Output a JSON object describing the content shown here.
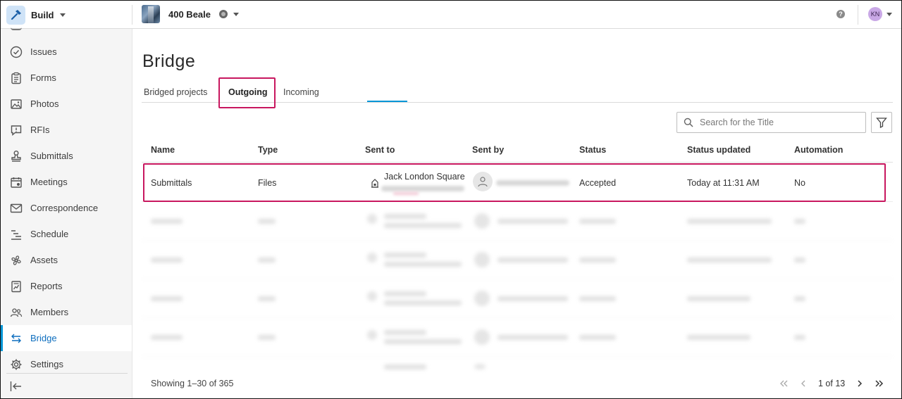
{
  "topbar": {
    "app_name": "Build",
    "project_name": "400 Beale",
    "user_initials": "KN"
  },
  "sidebar": {
    "items": [
      {
        "label": "Issues",
        "icon": "check-circle-icon"
      },
      {
        "label": "Forms",
        "icon": "clipboard-icon"
      },
      {
        "label": "Photos",
        "icon": "photos-icon"
      },
      {
        "label": "RFIs",
        "icon": "rfi-icon"
      },
      {
        "label": "Submittals",
        "icon": "stamp-icon"
      },
      {
        "label": "Meetings",
        "icon": "calendar-icon"
      },
      {
        "label": "Correspondence",
        "icon": "envelope-icon"
      },
      {
        "label": "Schedule",
        "icon": "schedule-icon"
      },
      {
        "label": "Assets",
        "icon": "fan-icon"
      },
      {
        "label": "Reports",
        "icon": "report-icon"
      },
      {
        "label": "Members",
        "icon": "members-icon"
      },
      {
        "label": "Bridge",
        "icon": "bridge-arrows-icon",
        "active": true
      },
      {
        "label": "Settings",
        "icon": "gear-icon"
      }
    ]
  },
  "page": {
    "title": "Bridge",
    "tabs": [
      "Bridged projects",
      "Outgoing",
      "Incoming"
    ],
    "active_tab": "Outgoing",
    "search_placeholder": "Search for the Title"
  },
  "table": {
    "columns": [
      "Name",
      "Type",
      "Sent to",
      "Sent by",
      "Status",
      "Status updated",
      "Automation"
    ],
    "rows": [
      {
        "name": "Submittals",
        "type": "Files",
        "sent_to": "Jack London Square",
        "status": "Accepted",
        "status_updated": "Today at 11:31 AM",
        "automation": "No"
      }
    ]
  },
  "pagination": {
    "summary": "Showing 1–30 of 365",
    "page_label": "1 of 13"
  },
  "colors": {
    "accent": "#0696d7",
    "highlight": "#c8175f"
  }
}
